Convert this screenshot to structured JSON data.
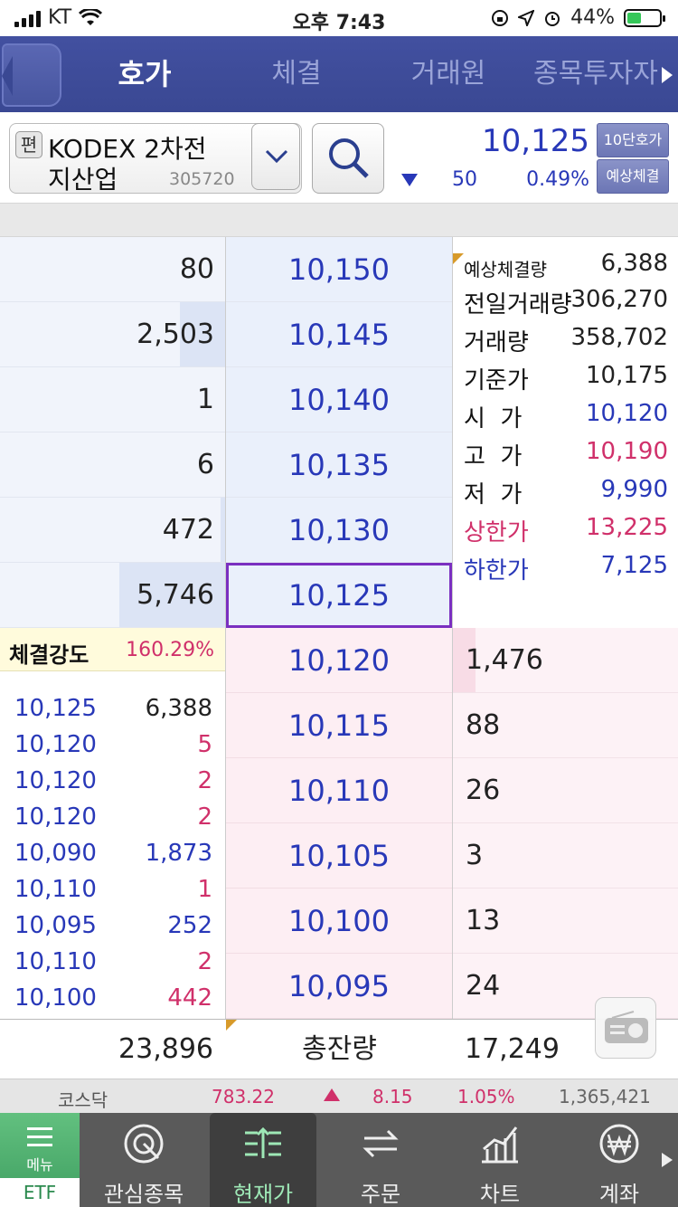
{
  "status_bar": {
    "carrier": "KT",
    "time": "오후 7:43",
    "battery": "44%"
  },
  "nav": {
    "tabs": [
      "호가",
      "체결",
      "거래원",
      "종목투자자"
    ],
    "active": 0
  },
  "stock": {
    "prefix": "편",
    "name_line1": "KODEX 2차전",
    "name_line2": "지산업",
    "code": "305720",
    "price": "10,125",
    "change": "50",
    "change_rate": "0.49%",
    "btn_levels": "10단호가",
    "btn_expected": "예상체결"
  },
  "colors": {
    "down": "#2838b8",
    "up": "#d0306a",
    "accent": "#7a2fc0"
  },
  "asks": [
    {
      "qty": "80",
      "price": "10,150",
      "fill": 0.0
    },
    {
      "qty": "2,503",
      "price": "10,145",
      "fill": 0.2
    },
    {
      "qty": "1",
      "price": "10,140",
      "fill": 0.0
    },
    {
      "qty": "6",
      "price": "10,135",
      "fill": 0.0
    },
    {
      "qty": "472",
      "price": "10,130",
      "fill": 0.02
    },
    {
      "qty": "5,746",
      "price": "10,125",
      "fill": 0.47
    }
  ],
  "bids": [
    {
      "price": "10,120",
      "qty": "1,476",
      "fill": 0.1
    },
    {
      "price": "10,115",
      "qty": "88",
      "fill": 0.0
    },
    {
      "price": "10,110",
      "qty": "26",
      "fill": 0.0
    },
    {
      "price": "10,105",
      "qty": "3",
      "fill": 0.0
    },
    {
      "price": "10,100",
      "qty": "13",
      "fill": 0.0
    },
    {
      "price": "10,095",
      "qty": "24",
      "fill": 0.0
    }
  ],
  "stats": [
    {
      "label": "예상체결량",
      "value": "6,388",
      "color": "#222222",
      "label_color": "#111111",
      "small": true
    },
    {
      "label": "전일거래량",
      "value": "306,270",
      "color": "#222222",
      "label_color": "#111111",
      "small": false
    },
    {
      "label": "거래량",
      "value": "358,702",
      "color": "#222222",
      "label_color": "#111111",
      "small": false
    },
    {
      "label": "기준가",
      "value": "10,175",
      "color": "#222222",
      "label_color": "#111111",
      "small": false
    },
    {
      "label": "시  가",
      "value": "10,120",
      "color": "#2838b8",
      "label_color": "#111111",
      "small": false
    },
    {
      "label": "고  가",
      "value": "10,190",
      "color": "#d0306a",
      "label_color": "#111111",
      "small": false
    },
    {
      "label": "저  가",
      "value": "9,990",
      "color": "#2838b8",
      "label_color": "#111111",
      "small": false
    },
    {
      "label": "상한가",
      "value": "13,225",
      "color": "#d0306a",
      "label_color": "#d0306a",
      "small": false
    },
    {
      "label": "하한가",
      "value": "7,125",
      "color": "#2838b8",
      "label_color": "#2838b8",
      "small": false
    }
  ],
  "strength": {
    "label": "체결강도",
    "value": "160.29%"
  },
  "trades": [
    {
      "price": "10,125",
      "qty": "6,388",
      "qty_color": "#222222"
    },
    {
      "price": "10,120",
      "qty": "5",
      "qty_color": "#d0306a"
    },
    {
      "price": "10,120",
      "qty": "2",
      "qty_color": "#d0306a"
    },
    {
      "price": "10,120",
      "qty": "2",
      "qty_color": "#d0306a"
    },
    {
      "price": "10,090",
      "qty": "1,873",
      "qty_color": "#2838b8"
    },
    {
      "price": "10,110",
      "qty": "1",
      "qty_color": "#d0306a"
    },
    {
      "price": "10,095",
      "qty": "252",
      "qty_color": "#2838b8"
    },
    {
      "price": "10,110",
      "qty": "2",
      "qty_color": "#d0306a"
    },
    {
      "price": "10,100",
      "qty": "442",
      "qty_color": "#d0306a"
    }
  ],
  "totals": {
    "ask_total": "23,896",
    "label": "총잔량",
    "bid_total": "17,249"
  },
  "ticker": {
    "index": "코스닥",
    "value": "783.22",
    "change": "8.15",
    "rate": "1.05%",
    "volume": "1,365,421"
  },
  "tabbar": {
    "menu": "메뉴",
    "etf": "ETF",
    "items": [
      "관심종목",
      "현재가",
      "주문",
      "차트",
      "계좌"
    ],
    "active": 1
  }
}
